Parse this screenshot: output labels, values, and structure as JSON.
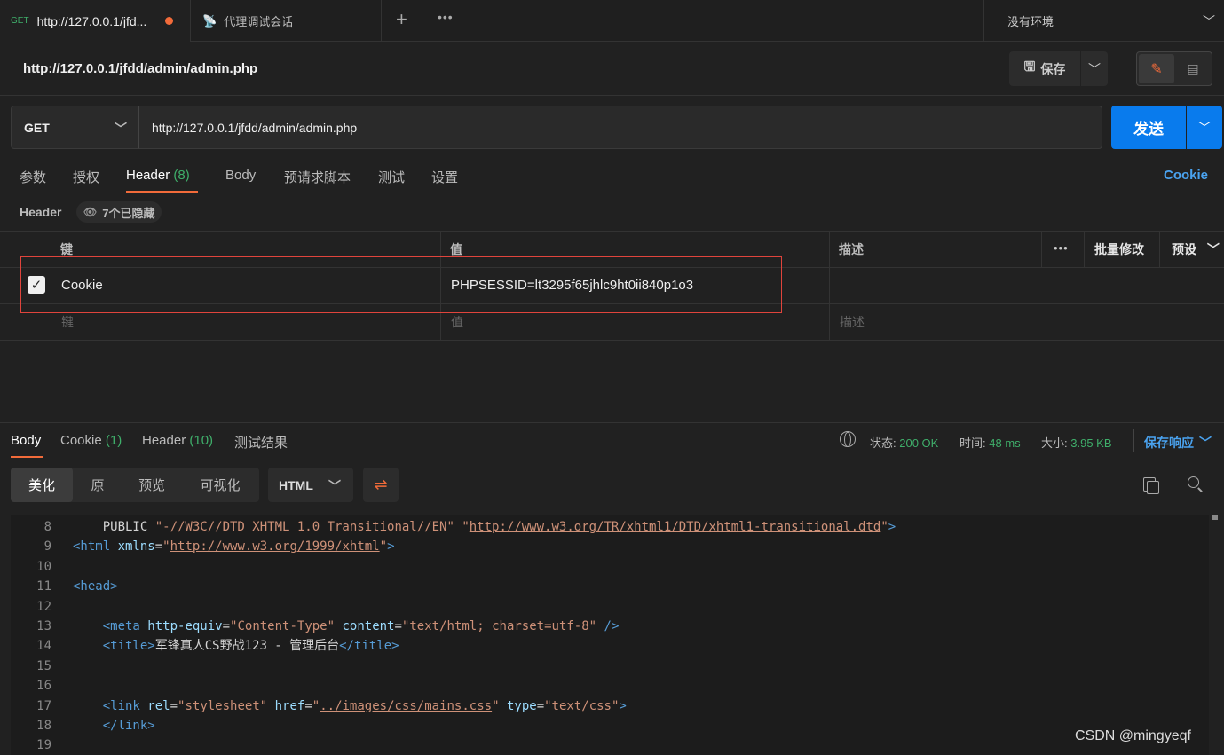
{
  "tabbar": {
    "active_tab": {
      "method": "GET",
      "title": "http://127.0.0.1/jfd..."
    },
    "second_tab": {
      "title": "代理调试会话"
    },
    "environment": "没有环境"
  },
  "request": {
    "title": "http://127.0.0.1/jfdd/admin/admin.php",
    "save_label": "保存",
    "method": "GET",
    "url": "http://127.0.0.1/jfdd/admin/admin.php",
    "send_label": "发送"
  },
  "request_tabs": [
    {
      "label": "参数"
    },
    {
      "label": "授权"
    },
    {
      "label": "Header",
      "count": "(8)"
    },
    {
      "label": "Body"
    },
    {
      "label": "预请求脚本"
    },
    {
      "label": "测试"
    },
    {
      "label": "设置"
    }
  ],
  "cookie_link": "Cookie",
  "headers": {
    "section_label": "Header",
    "hidden_badge": "7个已隐藏",
    "columns": {
      "key": "键",
      "value": "值",
      "description": "描述"
    },
    "bulk_edit": "批量修改",
    "presets": "预设",
    "rows": [
      {
        "checked": true,
        "key": "Cookie",
        "value": "PHPSESSID=lt3295f65jhlc9ht0ii840p1o3",
        "description": ""
      }
    ],
    "placeholder": {
      "key": "键",
      "value": "值",
      "description": "描述"
    }
  },
  "response": {
    "tabs": [
      {
        "label": "Body"
      },
      {
        "label": "Cookie",
        "count": "(1)"
      },
      {
        "label": "Header",
        "count": "(10)"
      },
      {
        "label": "测试结果"
      }
    ],
    "status_label": "状态:",
    "status_value": "200 OK",
    "time_label": "时间:",
    "time_value": "48 ms",
    "size_label": "大小:",
    "size_value": "3.95 KB",
    "save_response": "保存响应",
    "view_modes": [
      "美化",
      "原",
      "预览",
      "可视化"
    ],
    "format": "HTML"
  },
  "code_lines": [
    {
      "n": "8",
      "parts": [
        [
          "txt",
          "    PUBLIC "
        ],
        [
          "str",
          "\"-//W3C//DTD XHTML 1.0 Transitional//EN\""
        ],
        [
          "txt",
          " "
        ],
        [
          "str",
          "\""
        ],
        [
          "link",
          "http://www.w3.org/TR/xhtml1/DTD/xhtml1-transitional.dtd"
        ],
        [
          "str",
          "\""
        ],
        [
          "tag",
          ">"
        ]
      ]
    },
    {
      "n": "9",
      "parts": [
        [
          "tag",
          "<html "
        ],
        [
          "attr",
          "xmlns"
        ],
        [
          "txt",
          "="
        ],
        [
          "str",
          "\""
        ],
        [
          "link",
          "http://www.w3.org/1999/xhtml"
        ],
        [
          "str",
          "\""
        ],
        [
          "tag",
          ">"
        ]
      ]
    },
    {
      "n": "10",
      "parts": []
    },
    {
      "n": "11",
      "parts": [
        [
          "tag",
          "<head>"
        ]
      ]
    },
    {
      "n": "12",
      "parts": []
    },
    {
      "n": "13",
      "parts": [
        [
          "txt",
          "    "
        ],
        [
          "tag",
          "<meta "
        ],
        [
          "attr",
          "http-equiv"
        ],
        [
          "txt",
          "="
        ],
        [
          "str",
          "\"Content-Type\""
        ],
        [
          "txt",
          " "
        ],
        [
          "attr",
          "content"
        ],
        [
          "txt",
          "="
        ],
        [
          "str",
          "\"text/html; charset=utf-8\""
        ],
        [
          "txt",
          " "
        ],
        [
          "tag",
          "/>"
        ]
      ]
    },
    {
      "n": "14",
      "parts": [
        [
          "txt",
          "    "
        ],
        [
          "tag",
          "<title>"
        ],
        [
          "txt",
          "军锋真人CS野战123 - 管理后台"
        ],
        [
          "tag",
          "</title>"
        ]
      ]
    },
    {
      "n": "15",
      "parts": []
    },
    {
      "n": "16",
      "parts": []
    },
    {
      "n": "17",
      "parts": [
        [
          "txt",
          "    "
        ],
        [
          "tag",
          "<link "
        ],
        [
          "attr",
          "rel"
        ],
        [
          "txt",
          "="
        ],
        [
          "str",
          "\"stylesheet\""
        ],
        [
          "txt",
          " "
        ],
        [
          "attr",
          "href"
        ],
        [
          "txt",
          "="
        ],
        [
          "str",
          "\""
        ],
        [
          "link",
          "../images/css/mains.css"
        ],
        [
          "str",
          "\""
        ],
        [
          "txt",
          " "
        ],
        [
          "attr",
          "type"
        ],
        [
          "txt",
          "="
        ],
        [
          "str",
          "\"text/css\""
        ],
        [
          "tag",
          ">"
        ]
      ]
    },
    {
      "n": "18",
      "parts": [
        [
          "txt",
          "    "
        ],
        [
          "tag",
          "</link>"
        ]
      ]
    },
    {
      "n": "19",
      "parts": []
    }
  ],
  "watermark": "CSDN @mingyeqf"
}
